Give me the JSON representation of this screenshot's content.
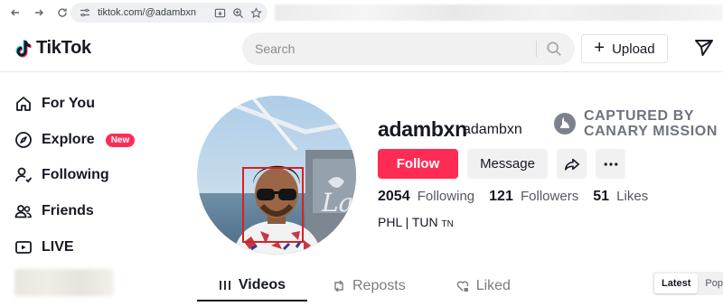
{
  "browser": {
    "url": "tiktok.com/@adambxn"
  },
  "header": {
    "brand": "TikTok",
    "search_placeholder": "Search",
    "upload_label": "Upload"
  },
  "sidebar": {
    "items": [
      {
        "label": "For You",
        "icon": "home-icon"
      },
      {
        "label": "Explore",
        "icon": "compass-icon",
        "badge": "New"
      },
      {
        "label": "Following",
        "icon": "user-follow-icon"
      },
      {
        "label": "Friends",
        "icon": "friends-icon"
      },
      {
        "label": "LIVE",
        "icon": "live-icon"
      }
    ]
  },
  "profile": {
    "username": "adambxn",
    "nickname": "adambxn",
    "follow_label": "Follow",
    "message_label": "Message",
    "stats": {
      "following": "2054",
      "following_label": "Following",
      "followers": "121",
      "followers_label": "Followers",
      "likes": "51",
      "likes_label": "Likes"
    },
    "bio": "PHL | TUN",
    "bio_flag": "TN"
  },
  "watermark": {
    "line1": "CAPTURED BY",
    "line2": "CANARY MISSION"
  },
  "tabs": [
    {
      "label": "Videos",
      "icon": "grid-icon",
      "active": true
    },
    {
      "label": "Reposts",
      "icon": "repost-icon",
      "active": false
    },
    {
      "label": "Liked",
      "icon": "heart-lock-icon",
      "active": false
    }
  ],
  "sort": {
    "options": [
      "Latest",
      "Pop"
    ],
    "selected": "Latest"
  },
  "colors": {
    "accent": "#fe2c55",
    "watermark": "#6f7380"
  }
}
